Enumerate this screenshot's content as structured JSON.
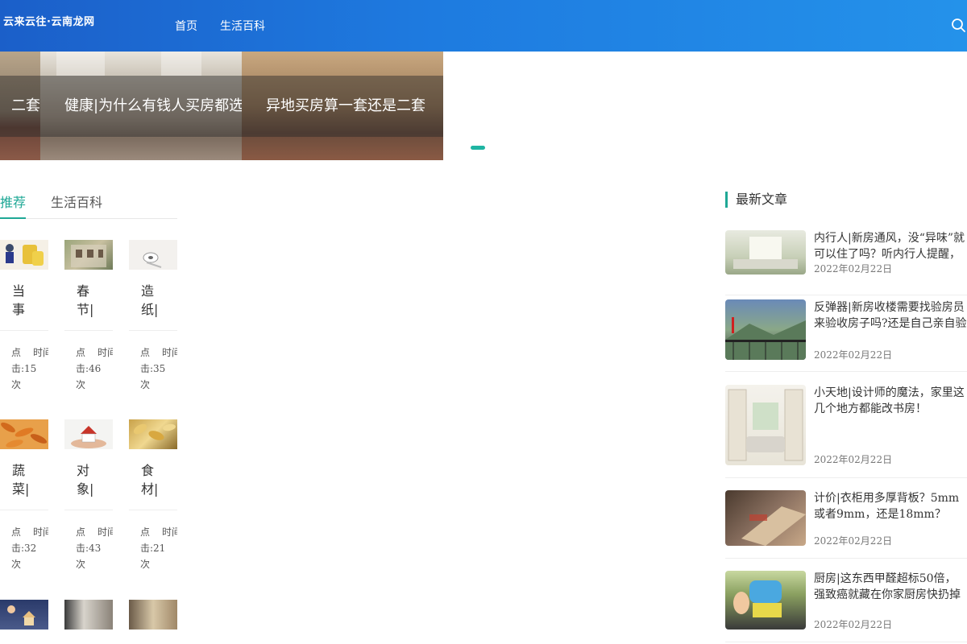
{
  "header": {
    "logo": "云来云往·云南龙网",
    "nav": [
      "首页",
      "生活百科"
    ]
  },
  "slider": {
    "slides": [
      "二套",
      "健康|为什么有钱人买房都选",
      "异地买房算一套还是二套"
    ],
    "active_dot_color": "#1fb5a3"
  },
  "tabs": {
    "recommend": "推荐",
    "life": "生活百科",
    "accent": "#1fa896"
  },
  "cards": [
    {
      "title": "当事",
      "click_label": "点击:15次",
      "time_label": "时间"
    },
    {
      "title": "春节|",
      "click_label": "点击:46次",
      "time_label": "时间"
    },
    {
      "title": "造纸|",
      "click_label": "点击:35次",
      "time_label": "时间"
    },
    {
      "title": "蔬菜|",
      "click_label": "点击:32次",
      "time_label": "时间"
    },
    {
      "title": "对象|",
      "click_label": "点击:43次",
      "time_label": "时间"
    },
    {
      "title": "食材|",
      "click_label": "点击:21次",
      "time_label": "时间"
    }
  ],
  "sidebar": {
    "title": "最新文章",
    "articles": [
      {
        "title": "内行人|新房通风，没“异味”就可以住了吗？听内行人提醒，",
        "date": "2022年02月22日"
      },
      {
        "title": "反弹器|新房收楼需要找验房员来验收房子吗?还是自己亲自验",
        "date": "2022年02月22日"
      },
      {
        "title": "小天地|设计师的魔法，家里这几个地方都能改书房！",
        "date": "2022年02月22日"
      },
      {
        "title": "计价|衣柜用多厚背板？5mm或者9mm，还是18mm？",
        "date": "2022年02月22日"
      },
      {
        "title": "厨房|这东西甲醛超标50倍，强致癌就藏在你家厨房快扔掉",
        "date": "2022年02月22日"
      }
    ]
  }
}
